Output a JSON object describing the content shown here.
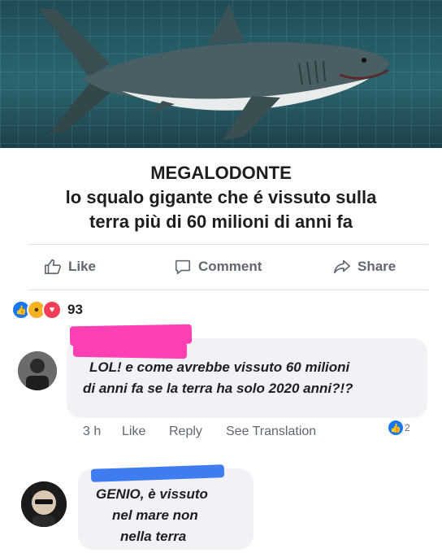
{
  "post": {
    "headline_lines": [
      "MEGALODONTE",
      "lo squalo gigante che é vissuto sulla",
      "terra più di 60 milioni di anni fa"
    ]
  },
  "actions": {
    "like": "Like",
    "comment": "Comment",
    "share": "Share"
  },
  "reactions": {
    "count": "93",
    "icons": [
      "like-icon",
      "wow-icon",
      "love-icon"
    ]
  },
  "comment1": {
    "lines": [
      "LOL! e come avrebbe vissuto 60 milioni",
      "di anni fa se la terra ha solo 2020 anni?!?"
    ],
    "time": "3 h",
    "like": "Like",
    "reply": "Reply",
    "translate": "See Translation",
    "reaction_count": "2"
  },
  "comment2": {
    "lines": [
      "GENIO, è vissuto",
      "nel mare non",
      "nella terra"
    ]
  },
  "colors": {
    "accent": "#1877f2",
    "bubble": "#f0f2f5",
    "redact_pink": "#ff3fb4",
    "redact_blue": "#3f7cf0"
  }
}
